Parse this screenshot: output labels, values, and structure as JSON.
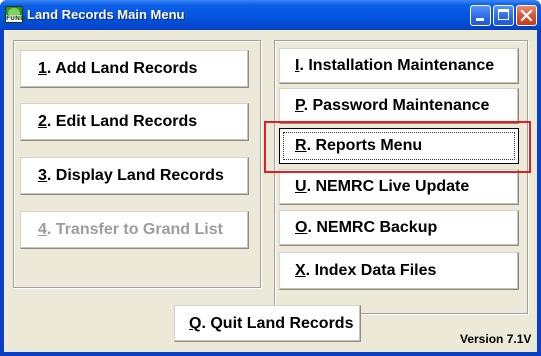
{
  "window": {
    "title": "Land Records Main Menu",
    "icon_text": "FUND"
  },
  "left_menu": [
    {
      "key": "1",
      "label": ". Add Land Records",
      "enabled": true
    },
    {
      "key": "2",
      "label": ". Edit Land Records",
      "enabled": true
    },
    {
      "key": "3",
      "label": ". Display Land Records",
      "enabled": true
    },
    {
      "key": "4",
      "label": ". Transfer to Grand List",
      "enabled": false
    }
  ],
  "right_menu": [
    {
      "key": "I",
      "label": ".  Installation Maintenance",
      "enabled": true
    },
    {
      "key": "P",
      "label": ". Password Maintenance",
      "enabled": true
    },
    {
      "key": "R",
      "label": ". Reports Menu",
      "enabled": true,
      "focused": true
    },
    {
      "key": "U",
      "label": ". NEMRC Live Update",
      "enabled": true
    },
    {
      "key": "O",
      "label": ". NEMRC Backup",
      "enabled": true
    },
    {
      "key": "X",
      "label": ".  Index Data Files",
      "enabled": true
    }
  ],
  "quit": {
    "key": "Q",
    "label": ". Quit Land Records"
  },
  "version": "Version 7.1V",
  "colors": {
    "titlebar": "#0555e0",
    "client": "#ece9d8",
    "highlight": "#e02020",
    "disabled_text": "#9d9d9d"
  }
}
